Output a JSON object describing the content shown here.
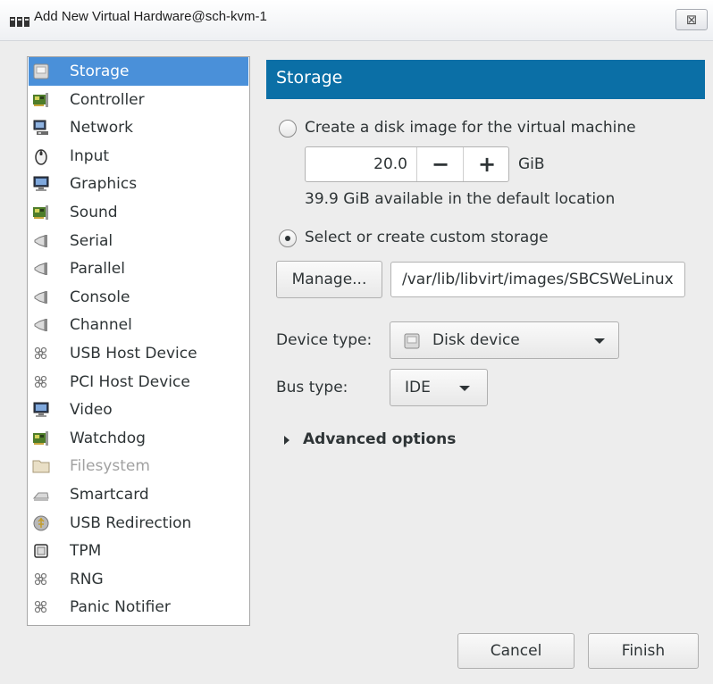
{
  "window": {
    "title": "Add New Virtual Hardware@sch-kvm-1",
    "close_glyph": "⊠",
    "icon": "virt-manager-icon"
  },
  "sidebar": {
    "items": [
      {
        "label": "Storage",
        "icon": "disk-icon",
        "selected": true,
        "disabled": false
      },
      {
        "label": "Controller",
        "icon": "pci-card-icon",
        "selected": false,
        "disabled": false
      },
      {
        "label": "Network",
        "icon": "network-icon",
        "selected": false,
        "disabled": false
      },
      {
        "label": "Input",
        "icon": "mouse-icon",
        "selected": false,
        "disabled": false
      },
      {
        "label": "Graphics",
        "icon": "monitor-icon",
        "selected": false,
        "disabled": false
      },
      {
        "label": "Sound",
        "icon": "pci-card-icon",
        "selected": false,
        "disabled": false
      },
      {
        "label": "Serial",
        "icon": "plug-icon",
        "selected": false,
        "disabled": false
      },
      {
        "label": "Parallel",
        "icon": "plug-icon",
        "selected": false,
        "disabled": false
      },
      {
        "label": "Console",
        "icon": "plug-icon",
        "selected": false,
        "disabled": false
      },
      {
        "label": "Channel",
        "icon": "plug-icon",
        "selected": false,
        "disabled": false
      },
      {
        "label": "USB Host Device",
        "icon": "device-icon",
        "selected": false,
        "disabled": false
      },
      {
        "label": "PCI Host Device",
        "icon": "device-icon",
        "selected": false,
        "disabled": false
      },
      {
        "label": "Video",
        "icon": "monitor-icon",
        "selected": false,
        "disabled": false
      },
      {
        "label": "Watchdog",
        "icon": "pci-card-icon",
        "selected": false,
        "disabled": false
      },
      {
        "label": "Filesystem",
        "icon": "folder-icon",
        "selected": false,
        "disabled": true
      },
      {
        "label": "Smartcard",
        "icon": "smartcard-icon",
        "selected": false,
        "disabled": false
      },
      {
        "label": "USB Redirection",
        "icon": "usb-icon",
        "selected": false,
        "disabled": false
      },
      {
        "label": "TPM",
        "icon": "chip-icon",
        "selected": false,
        "disabled": false
      },
      {
        "label": "RNG",
        "icon": "device-icon",
        "selected": false,
        "disabled": false
      },
      {
        "label": "Panic Notifier",
        "icon": "device-icon",
        "selected": false,
        "disabled": false
      }
    ]
  },
  "panel": {
    "title": "Storage",
    "create_option": {
      "label": "Create a disk image for the virtual machine",
      "checked": false
    },
    "size": {
      "value": "20.0",
      "minus": "−",
      "plus": "+",
      "unit": "GiB"
    },
    "available_text": "39.9 GiB available in the default location",
    "custom_option": {
      "label": "Select or create custom storage",
      "checked": true
    },
    "manage_button": "Manage...",
    "path_value": "/var/lib/libvirt/images/SBCSWeLinux",
    "device_type_label": "Device type:",
    "device_type_value": "Disk device",
    "bus_type_label": "Bus type:",
    "bus_type_value": "IDE",
    "advanced_label": "Advanced options"
  },
  "buttons": {
    "cancel": "Cancel",
    "finish": "Finish"
  },
  "colors": {
    "accent": "#0b6fa6",
    "selection": "#4a90d9"
  }
}
